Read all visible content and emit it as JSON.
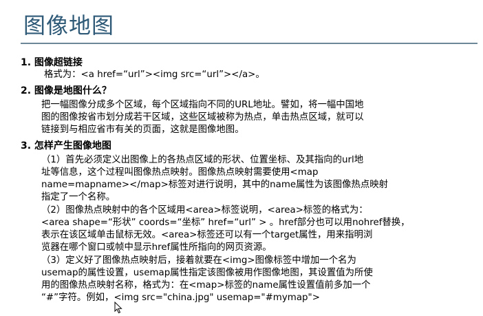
{
  "title": "图像地图",
  "sections": [
    {
      "heading": "1. 图像超链接",
      "lines": [
        "格式为：<a href=“url”><img src=“url”></a>。"
      ]
    },
    {
      "heading": "2. 图像是地图什么？",
      "lines": [
        "把一幅图像分成多个区域，每个区域指向不同的URL地址。譬如，将一幅中国地",
        "图的图像按省市划分成若干区域，这些区域被称为热点，单击热点区域，就可以",
        "链接到与相应省市有关的页面，这就是图像地图。"
      ]
    },
    {
      "heading": "3. 怎样产生图像地图",
      "paragraphs": [
        [
          "（1）首先必须定义出图像上的各热点区域的形状、位置坐标、及其指向的url地",
          "址等信息，这个过程叫图像热点映射。图像热点映射需要使用<map",
          "name=mapname></map>标签对进行说明，其中的name属性为该图像热点映射",
          "指定了一个名称。"
        ],
        [
          "（2）图像热点映射中的各个区域用<area>标签说明，<area>标签的格式为：",
          "<area shape=“形状” coords=“坐标” href=“url” > 。href部分也可以用nohref替换，",
          "表示在该区域单击鼠标无效。<area>标签还可以有一个target属性，用来指明浏",
          "览器在哪个窗口或帧中显示href属性所指向的网页资源。"
        ],
        [
          "（3）定义好了图像热点映射后，接着就要在<img>图像标签中增加一个名为",
          "usemap的属性设置，usemap属性指定该图像被用作图像地图，其设置值为所使",
          "用的图像热点映射名称，格式为：在<map>标签的name属性设置值前多加一个",
          "“#”字符。例如，<img src=\"china.jpg\" usemap=\"#mymap\">"
        ]
      ]
    }
  ],
  "colors": {
    "title": "#2e5a78",
    "rule": "#6c8797",
    "text": "#000000"
  },
  "icons": {
    "cursor": "mouse-pointer-icon"
  }
}
